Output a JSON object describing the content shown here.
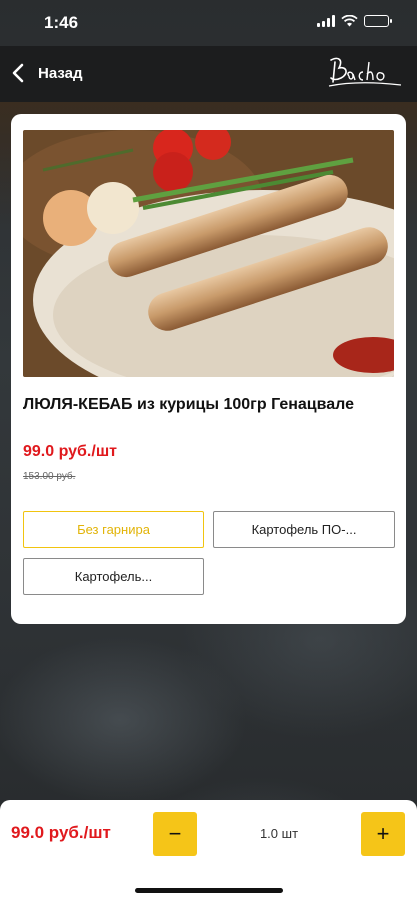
{
  "status_bar": {
    "time": "1:46"
  },
  "nav": {
    "back_label": "Назад",
    "logo_text": "Bacho"
  },
  "product": {
    "title": "ЛЮЛЯ-КЕБАБ из курицы 100гр Генацвале",
    "price": "99.0 руб./шт",
    "old_price": "153.00 руб."
  },
  "options": [
    {
      "label": "Без гарнира",
      "selected": true
    },
    {
      "label": "Картофель ПО-...",
      "selected": false
    },
    {
      "label": "Картофель...",
      "selected": false
    }
  ],
  "order_bar": {
    "price": "99.0 руб./шт",
    "minus_label": "−",
    "plus_label": "+",
    "quantity": "1.0 шт"
  },
  "colors": {
    "accent": "#f5c518",
    "price": "#e0191d",
    "navbar": "#1c1d1e"
  }
}
